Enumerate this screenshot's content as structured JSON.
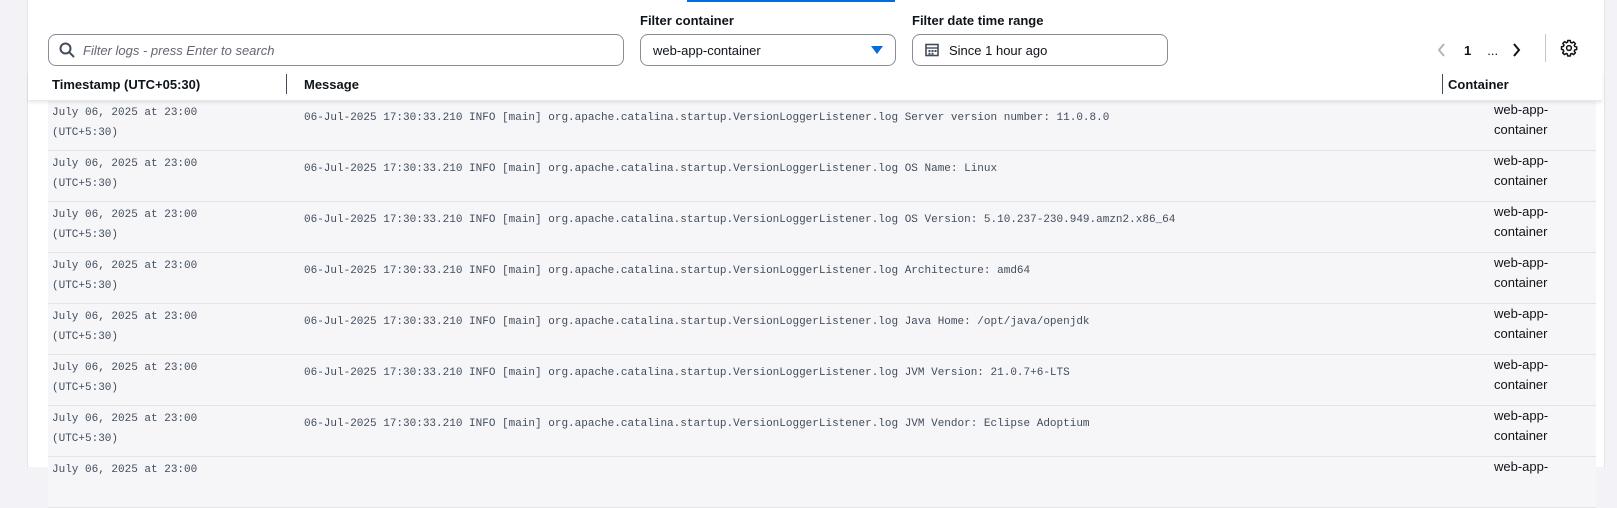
{
  "filters": {
    "container_label": "Filter container",
    "date_label": "Filter date time range",
    "search_placeholder": "Filter logs - press Enter to search",
    "container_value": "web-app-container",
    "date_value": "Since 1 hour ago"
  },
  "pagination": {
    "current_page": "1",
    "ellipsis": "..."
  },
  "table": {
    "columns": {
      "timestamp": "Timestamp (UTC+05:30)",
      "message": "Message",
      "container": "Container"
    },
    "rows": [
      {
        "ts1": "July 06, 2025 at 23:00",
        "ts2": "(UTC+5:30)",
        "message": "06-Jul-2025 17:30:33.210 INFO [main] org.apache.catalina.startup.VersionLoggerListener.log Server version number: 11.0.8.0",
        "c1": "web-app-",
        "c2": "container"
      },
      {
        "ts1": "July 06, 2025 at 23:00",
        "ts2": "(UTC+5:30)",
        "message": "06-Jul-2025 17:30:33.210 INFO [main] org.apache.catalina.startup.VersionLoggerListener.log OS Name: Linux",
        "c1": "web-app-",
        "c2": "container"
      },
      {
        "ts1": "July 06, 2025 at 23:00",
        "ts2": "(UTC+5:30)",
        "message": "06-Jul-2025 17:30:33.210 INFO [main] org.apache.catalina.startup.VersionLoggerListener.log OS Version: 5.10.237-230.949.amzn2.x86_64",
        "c1": "web-app-",
        "c2": "container"
      },
      {
        "ts1": "July 06, 2025 at 23:00",
        "ts2": "(UTC+5:30)",
        "message": "06-Jul-2025 17:30:33.210 INFO [main] org.apache.catalina.startup.VersionLoggerListener.log Architecture: amd64",
        "c1": "web-app-",
        "c2": "container"
      },
      {
        "ts1": "July 06, 2025 at 23:00",
        "ts2": "(UTC+5:30)",
        "message": "06-Jul-2025 17:30:33.210 INFO [main] org.apache.catalina.startup.VersionLoggerListener.log Java Home: /opt/java/openjdk",
        "c1": "web-app-",
        "c2": "container"
      },
      {
        "ts1": "July 06, 2025 at 23:00",
        "ts2": "(UTC+5:30)",
        "message": "06-Jul-2025 17:30:33.210 INFO [main] org.apache.catalina.startup.VersionLoggerListener.log JVM Version: 21.0.7+6-LTS",
        "c1": "web-app-",
        "c2": "container"
      },
      {
        "ts1": "July 06, 2025 at 23:00",
        "ts2": "(UTC+5:30)",
        "message": "06-Jul-2025 17:30:33.210 INFO [main] org.apache.catalina.startup.VersionLoggerListener.log JVM Vendor: Eclipse Adoptium",
        "c1": "web-app-",
        "c2": "container"
      },
      {
        "ts1": "July 06, 2025 at 23:00",
        "ts2": "",
        "message": "",
        "c1": "web-app-",
        "c2": ""
      }
    ]
  },
  "colors": {
    "accent": "#006ce0",
    "row_bg": "#f6f6f9",
    "text_muted": "#414d5c"
  }
}
